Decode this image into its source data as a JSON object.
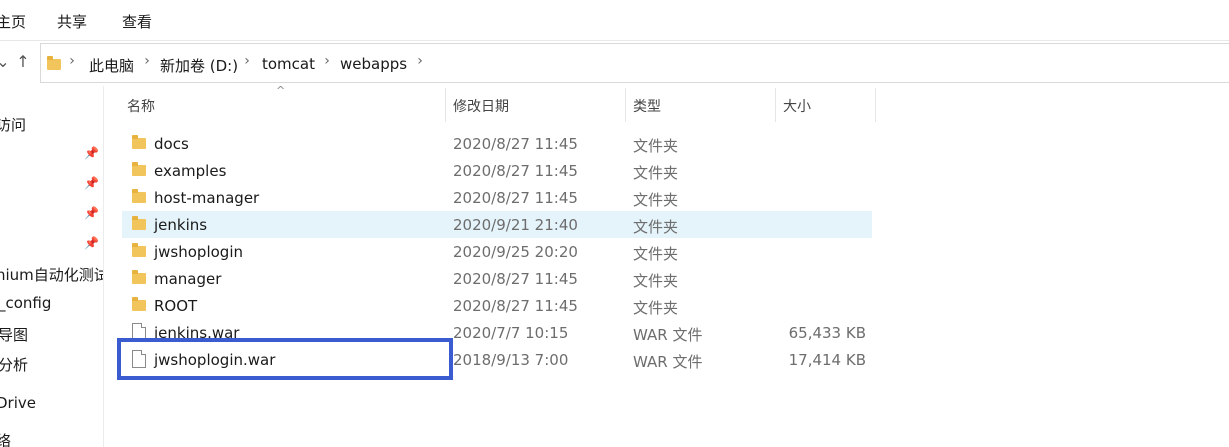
{
  "ribbon": {
    "tabs": [
      "主页",
      "共享",
      "查看"
    ]
  },
  "address": {
    "crumbs": [
      "此电脑",
      "新加卷 (D:)",
      "tomcat",
      "webapps"
    ]
  },
  "nav_pane": {
    "items": [
      "访问",
      "",
      "",
      "",
      "",
      "nium自动化测试",
      "_config",
      "导图",
      "分析",
      "Drive",
      "络"
    ]
  },
  "columns": {
    "name": "名称",
    "date": "修改日期",
    "type": "类型",
    "size": "大小"
  },
  "files": [
    {
      "name": "docs",
      "date": "2020/8/27 11:45",
      "type": "文件夹",
      "size": "",
      "kind": "folder"
    },
    {
      "name": "examples",
      "date": "2020/8/27 11:45",
      "type": "文件夹",
      "size": "",
      "kind": "folder"
    },
    {
      "name": "host-manager",
      "date": "2020/8/27 11:45",
      "type": "文件夹",
      "size": "",
      "kind": "folder"
    },
    {
      "name": "jenkins",
      "date": "2020/9/21 21:40",
      "type": "文件夹",
      "size": "",
      "kind": "folder",
      "selected": true
    },
    {
      "name": "jwshoplogin",
      "date": "2020/9/25 20:20",
      "type": "文件夹",
      "size": "",
      "kind": "folder"
    },
    {
      "name": "manager",
      "date": "2020/8/27 11:45",
      "type": "文件夹",
      "size": "",
      "kind": "folder"
    },
    {
      "name": "ROOT",
      "date": "2020/8/27 11:45",
      "type": "文件夹",
      "size": "",
      "kind": "folder"
    },
    {
      "name": "jenkins.war",
      "date": "2020/7/7 10:15",
      "type": "WAR 文件",
      "size": "65,433 KB",
      "kind": "file"
    },
    {
      "name": "jwshoplogin.war",
      "date": "2018/9/13 7:00",
      "type": "WAR 文件",
      "size": "17,414 KB",
      "kind": "file"
    }
  ],
  "colors": {
    "selection": "#e5f3fb",
    "highlight_box": "#3b5bd1",
    "folder": "#f2c55c"
  }
}
